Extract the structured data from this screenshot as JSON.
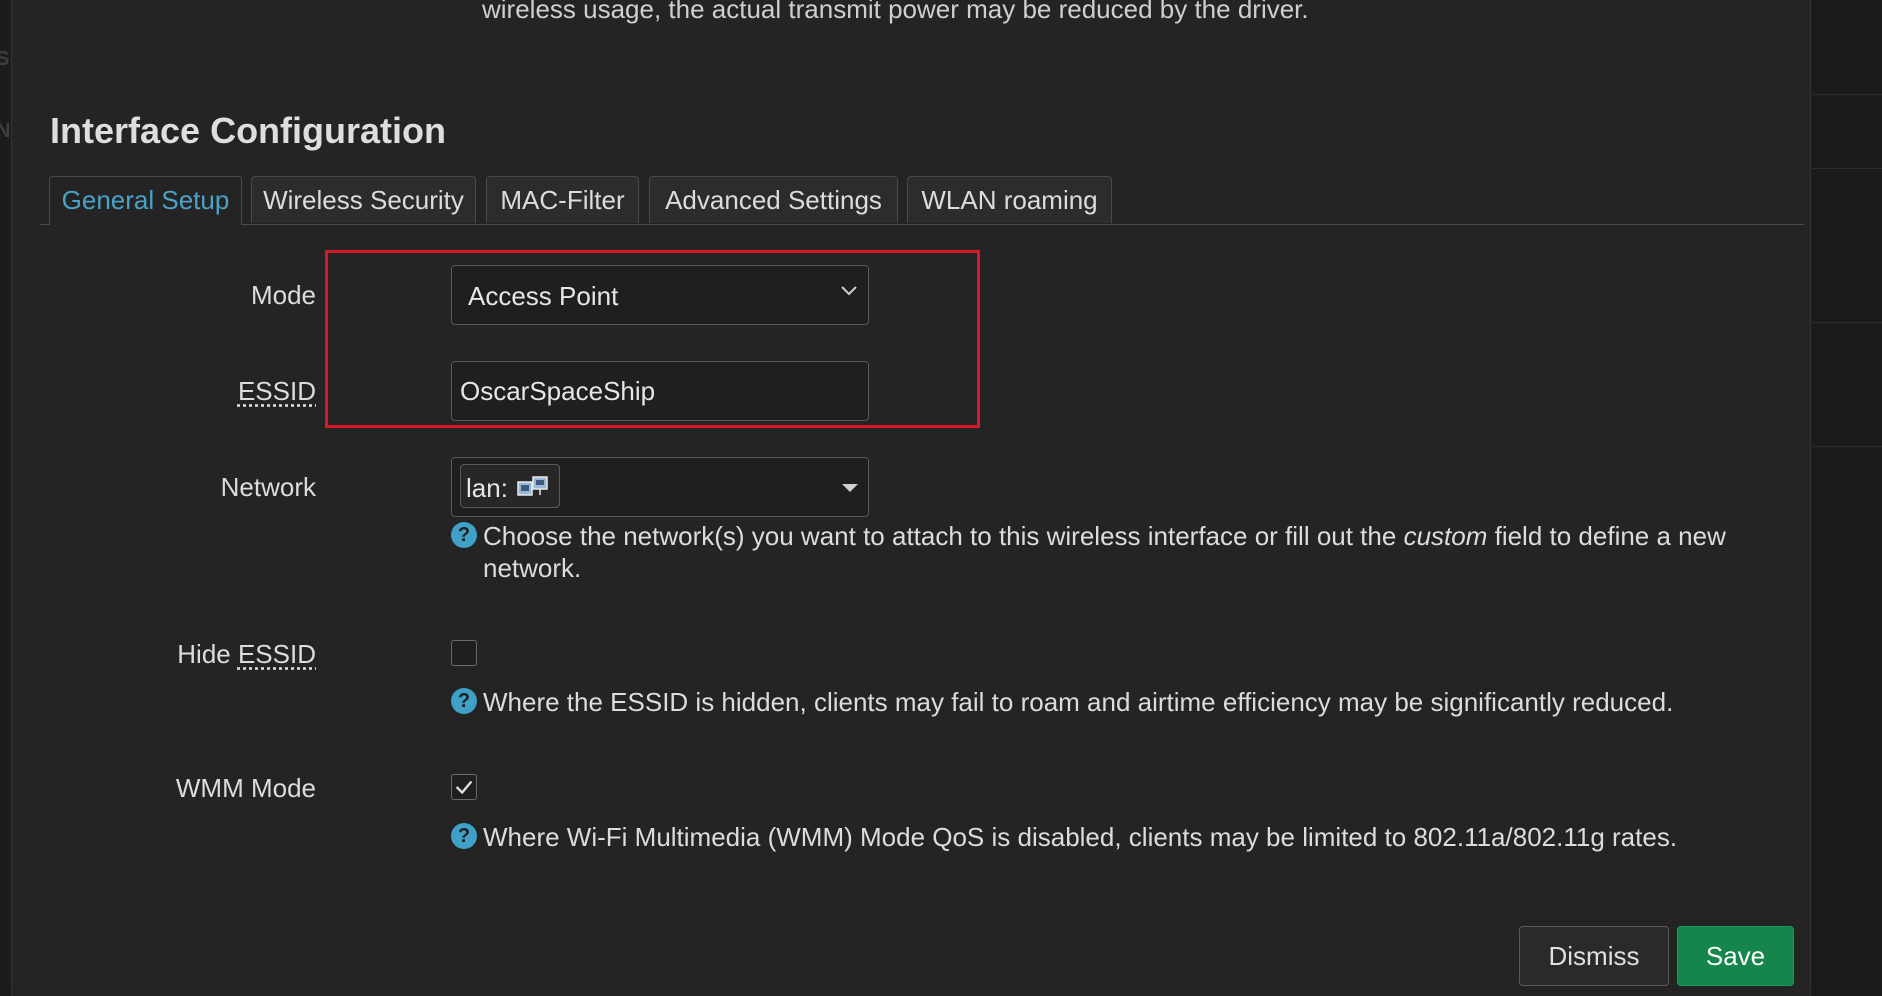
{
  "background": {
    "edge_letters": [
      "S",
      "N"
    ]
  },
  "modal": {
    "top_text": "wireless usage, the actual transmit power may be reduced by the driver.",
    "section_title": "Interface Configuration",
    "tabs": [
      {
        "label": "General Setup",
        "active": true
      },
      {
        "label": "Wireless Security",
        "active": false
      },
      {
        "label": "MAC-Filter",
        "active": false
      },
      {
        "label": "Advanced Settings",
        "active": false
      },
      {
        "label": "WLAN roaming",
        "active": false
      }
    ],
    "fields": {
      "mode": {
        "label": "Mode",
        "value": "Access Point"
      },
      "essid": {
        "label": "ESSID",
        "value": "OscarSpaceShip"
      },
      "network": {
        "label": "Network",
        "chip_text": "lan:",
        "help_before": "Choose the network(s) you want to attach to this wireless interface or fill out the ",
        "help_em": "custom",
        "help_after": " field to define a new network."
      },
      "hide_essid": {
        "label_prefix": "Hide ",
        "label_abbr": "ESSID",
        "checked": false,
        "help": "Where the ESSID is hidden, clients may fail to roam and airtime efficiency may be significantly reduced."
      },
      "wmm_mode": {
        "label": "WMM Mode",
        "checked": true,
        "help": "Where Wi-Fi Multimedia (WMM) Mode QoS is disabled, clients may be limited to 802.11a/802.11g rates."
      }
    },
    "help_icon_glyph": "?",
    "buttons": {
      "dismiss": "Dismiss",
      "save": "Save"
    }
  },
  "colors": {
    "active_tab": "#4aa3c7",
    "highlight_border": "#d9182a",
    "save_button": "#16854b",
    "help_icon": "#3fa0c8"
  }
}
